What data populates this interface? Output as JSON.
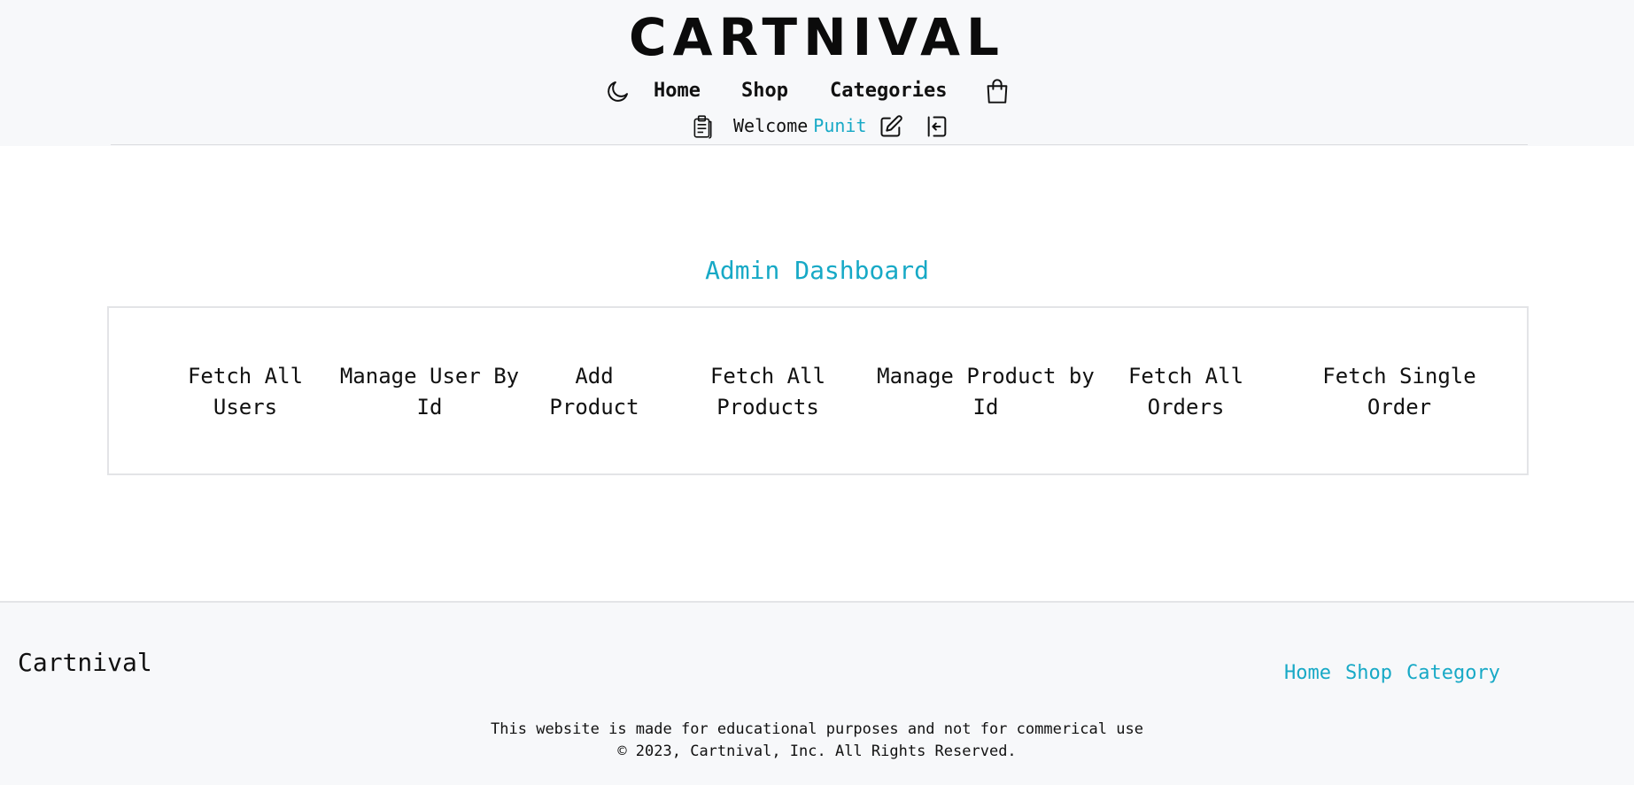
{
  "header": {
    "brand": "CARTNIVAL",
    "nav": {
      "theme_icon": "moon-icon",
      "home": "Home",
      "shop": "Shop",
      "categories": "Categories",
      "cart_icon": "shopping-bag-icon"
    },
    "user": {
      "orders_icon": "clipboard-icon",
      "welcome": "Welcome",
      "username": "Punit",
      "edit_icon": "edit-icon",
      "logout_icon": "logout-icon"
    }
  },
  "dashboard": {
    "title": "Admin Dashboard",
    "actions": [
      {
        "label": "Fetch All Users"
      },
      {
        "label": "Manage User By Id"
      },
      {
        "label": "Add Product"
      },
      {
        "label": "Fetch All Products"
      },
      {
        "label": "Manage Product by Id"
      },
      {
        "label": "Fetch All Orders"
      },
      {
        "label": "Fetch Single Order"
      }
    ]
  },
  "footer": {
    "brand": "Cartnival",
    "links": {
      "home": "Home",
      "shop": "Shop",
      "category": "Category"
    },
    "note": "This website is made for educational purposes and not for commerical use",
    "copyright": "© 2023, Cartnival, Inc. All Rights Reserved."
  },
  "colors": {
    "accent": "#17a9c6",
    "text": "#111111",
    "header_bg": "#f7f8fa"
  }
}
